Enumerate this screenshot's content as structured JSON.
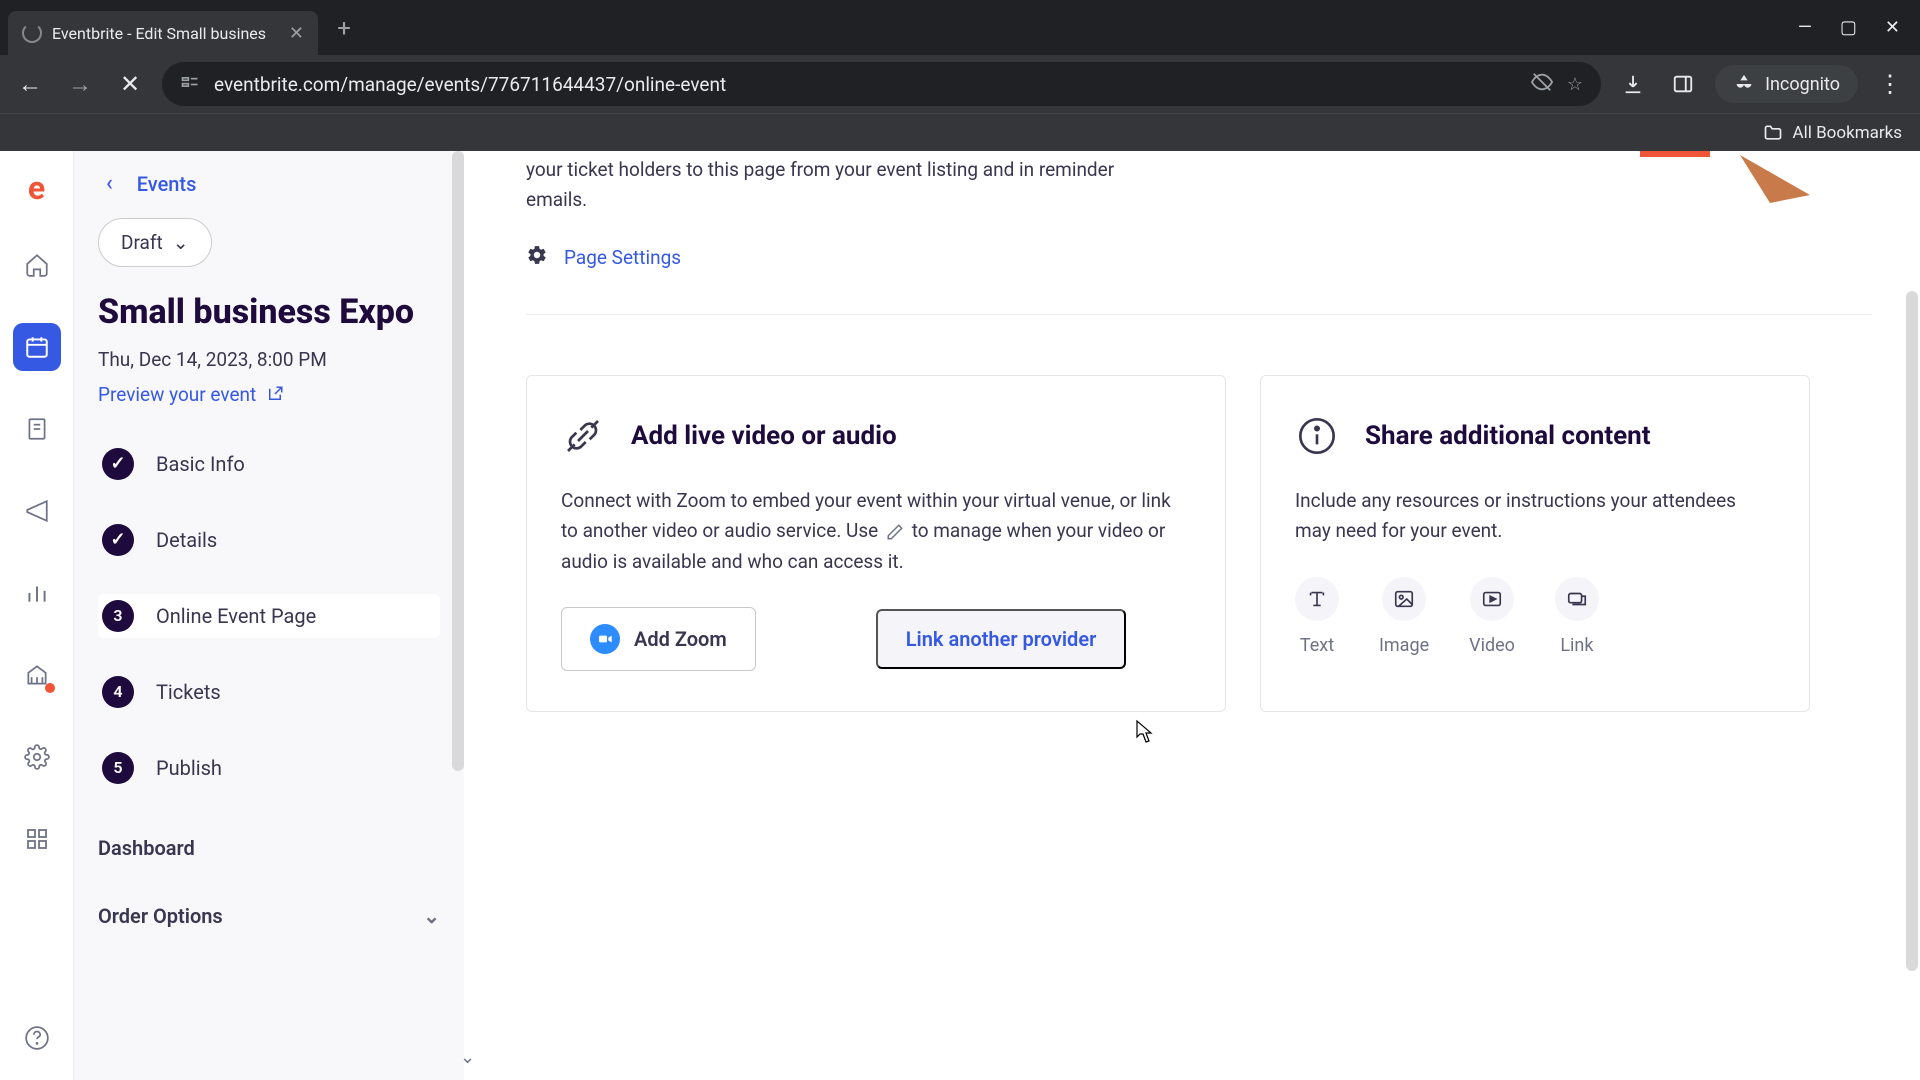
{
  "browser": {
    "tab_title": "Eventbrite - Edit Small busines",
    "url": "eventbrite.com/manage/events/776711644437/online-event",
    "incognito_label": "Incognito",
    "bookmarks_label": "All Bookmarks"
  },
  "sidebar": {
    "back_label": "Events",
    "status": "Draft",
    "event_title": "Small business Expo",
    "event_date": "Thu, Dec 14, 2023, 8:00 PM",
    "preview_label": "Preview your event",
    "steps": [
      {
        "label": "Basic Info",
        "done": true
      },
      {
        "label": "Details",
        "done": true
      },
      {
        "label": "Online Event Page",
        "num": "3",
        "active": true
      },
      {
        "label": "Tickets",
        "num": "4"
      },
      {
        "label": "Publish",
        "num": "5"
      }
    ],
    "dashboard_label": "Dashboard",
    "order_options_label": "Order Options"
  },
  "main": {
    "intro_tail": "your ticket holders to this page from your event listing and in reminder emails.",
    "page_settings_label": "Page Settings",
    "live_card": {
      "title": "Add live video or audio",
      "desc_a": "Connect with Zoom to embed your event within your virtual venue, or link to another video or audio service. Use ",
      "desc_b": " to manage when your video or audio is available and who can access it.",
      "add_zoom_label": "Add Zoom",
      "link_provider_label": "Link another provider"
    },
    "share_card": {
      "title": "Share additional content",
      "desc": "Include any resources or instructions your attendees may need for your event.",
      "types": [
        "Text",
        "Image",
        "Video",
        "Link"
      ]
    }
  }
}
